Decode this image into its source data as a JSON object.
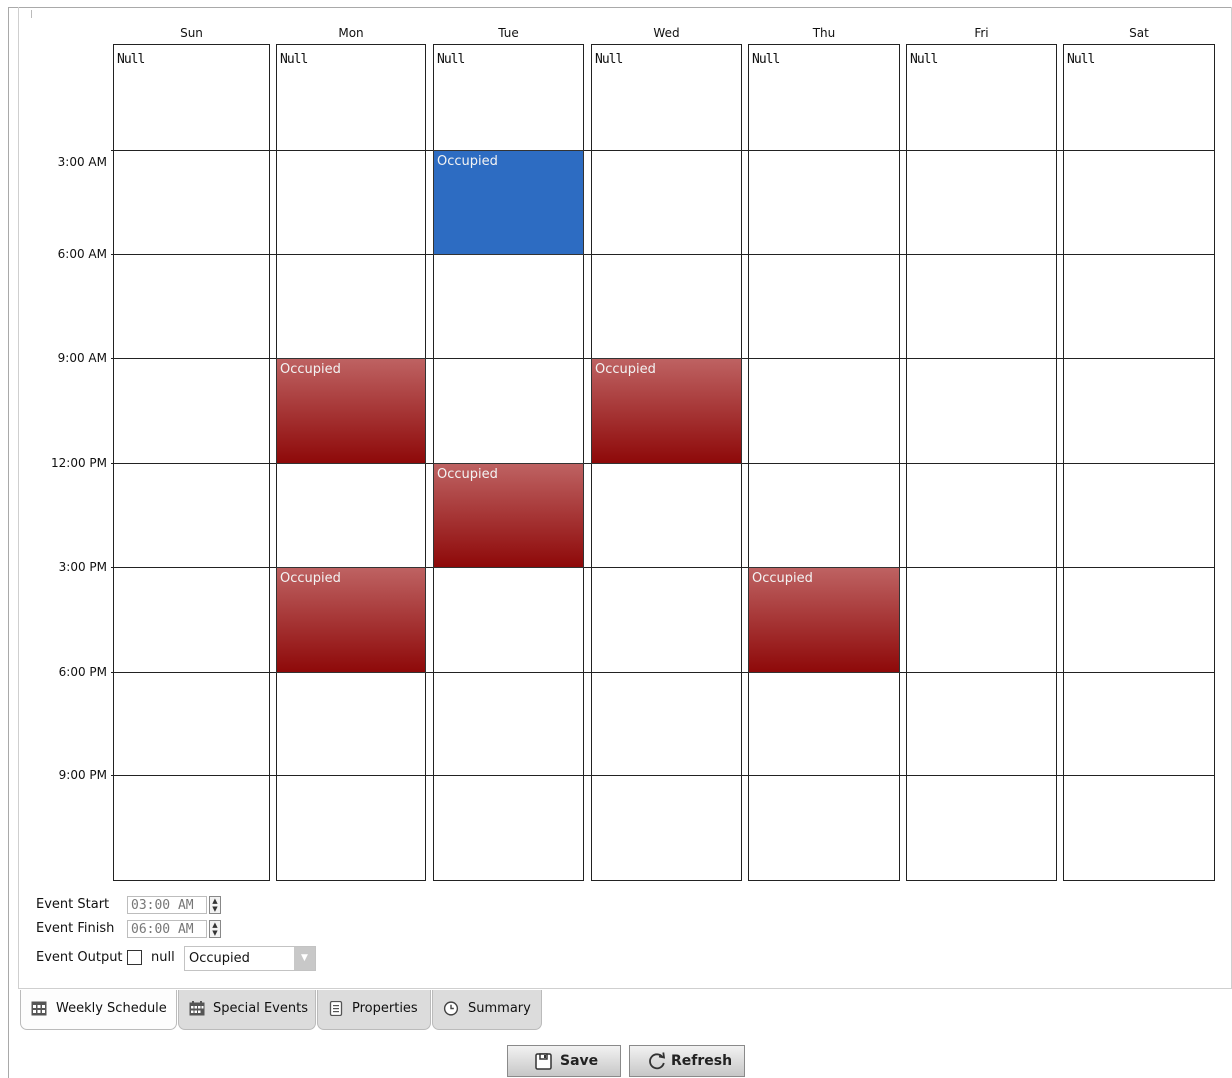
{
  "days": [
    "Sun",
    "Mon",
    "Tue",
    "Wed",
    "Thu",
    "Fri",
    "Sat"
  ],
  "null_label": "Null",
  "time_labels": [
    "3:00 AM",
    "6:00 AM",
    "9:00 AM",
    "12:00 PM",
    "3:00 PM",
    "6:00 PM",
    "9:00 PM"
  ],
  "events": [
    {
      "day": "Tue",
      "label": "Occupied",
      "start": "3:00 AM",
      "end": "6:00 AM",
      "color": "#2d6cc2",
      "selected": true
    },
    {
      "day": "Mon",
      "label": "Occupied",
      "start": "9:00 AM",
      "end": "12:00 PM",
      "color": "#9b1d1d"
    },
    {
      "day": "Wed",
      "label": "Occupied",
      "start": "9:00 AM",
      "end": "12:00 PM",
      "color": "#9b1d1d"
    },
    {
      "day": "Tue",
      "label": "Occupied",
      "start": "12:00 PM",
      "end": "3:00 PM",
      "color": "#9b1d1d"
    },
    {
      "day": "Mon",
      "label": "Occupied",
      "start": "3:00 PM",
      "end": "6:00 PM",
      "color": "#9b1d1d"
    },
    {
      "day": "Thu",
      "label": "Occupied",
      "start": "3:00 PM",
      "end": "6:00 PM",
      "color": "#9b1d1d"
    }
  ],
  "editor": {
    "start_label": "Event Start",
    "start_value": "03:00 AM",
    "finish_label": "Event Finish",
    "finish_value": "06:00 AM",
    "output_label": "Event Output",
    "null_text": "null",
    "output_value": "Occupied"
  },
  "tabs": [
    "Weekly Schedule",
    "Special Events",
    "Properties",
    "Summary"
  ],
  "buttons": {
    "save": "Save",
    "refresh": "Refresh"
  }
}
